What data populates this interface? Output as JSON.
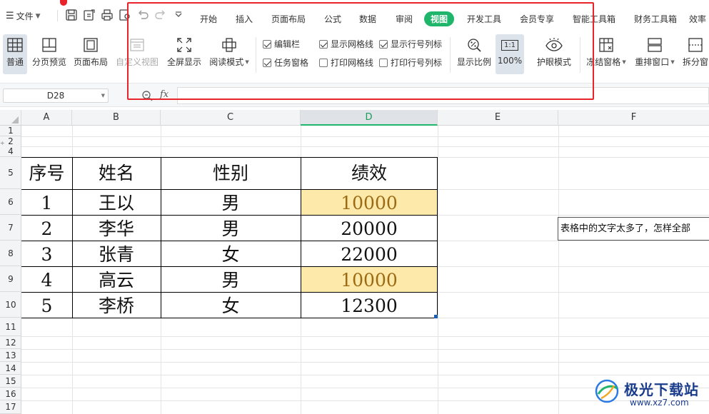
{
  "menu": {
    "file_label": "文件"
  },
  "tabs": [
    {
      "label": "开始"
    },
    {
      "label": "插入"
    },
    {
      "label": "页面布局"
    },
    {
      "label": "公式"
    },
    {
      "label": "数据"
    },
    {
      "label": "审阅"
    },
    {
      "label": "视图"
    },
    {
      "label": "开发工具"
    },
    {
      "label": "会员专享"
    },
    {
      "label": "智能工具箱"
    },
    {
      "label": "财务工具箱"
    },
    {
      "label": "效率"
    }
  ],
  "active_tab": "视图",
  "toolbar": {
    "normal": "普通",
    "page_break_preview": "分页预览",
    "page_layout": "页面布局",
    "custom_view": "自定义视图",
    "fullscreen": "全屏显示",
    "reading_mode": "阅读模式",
    "zoom": "显示比例",
    "zoom_100": "100%",
    "zoom_100_icon_text": "1:1",
    "eye_protection": "护眼模式",
    "freeze_panes": "冻结窗格",
    "arrange_windows": "重排窗口",
    "split_window": "拆分窗"
  },
  "checkboxes": [
    {
      "label": "编辑栏",
      "checked": true
    },
    {
      "label": "显示网格线",
      "checked": true
    },
    {
      "label": "显示行号列标",
      "checked": true
    },
    {
      "label": "任务窗格",
      "checked": true
    },
    {
      "label": "打印网格线",
      "checked": false
    },
    {
      "label": "打印行号列标",
      "checked": false
    }
  ],
  "formula_bar": {
    "name_box": "D28",
    "fx_label": "fx",
    "formula": ""
  },
  "columns": [
    "A",
    "B",
    "C",
    "D",
    "E",
    "F"
  ],
  "rows": [
    "1",
    "2",
    "4",
    "5",
    "6",
    "7",
    "8",
    "9",
    "10",
    "11",
    "12",
    "13",
    "14",
    "15",
    "16",
    "17"
  ],
  "table": {
    "headers": [
      "序号",
      "姓名",
      "性别",
      "绩效"
    ],
    "rows": [
      [
        "1",
        "王以",
        "男",
        "10000"
      ],
      [
        "2",
        "李华",
        "男",
        "20000"
      ],
      [
        "3",
        "张青",
        "女",
        "22000"
      ],
      [
        "4",
        "高云",
        "男",
        "10000"
      ],
      [
        "5",
        "李桥",
        "女",
        "12300"
      ]
    ]
  },
  "note_text": "表格中的文字太多了，怎样全部",
  "watermark": {
    "text": "极光下载站",
    "url": "www.xz7.com"
  },
  "colors": {
    "accent": "#1fb56a",
    "highlight_fill": "#fde9a9",
    "highlight_text": "#9c6a12",
    "red_box": "#e8242a"
  }
}
